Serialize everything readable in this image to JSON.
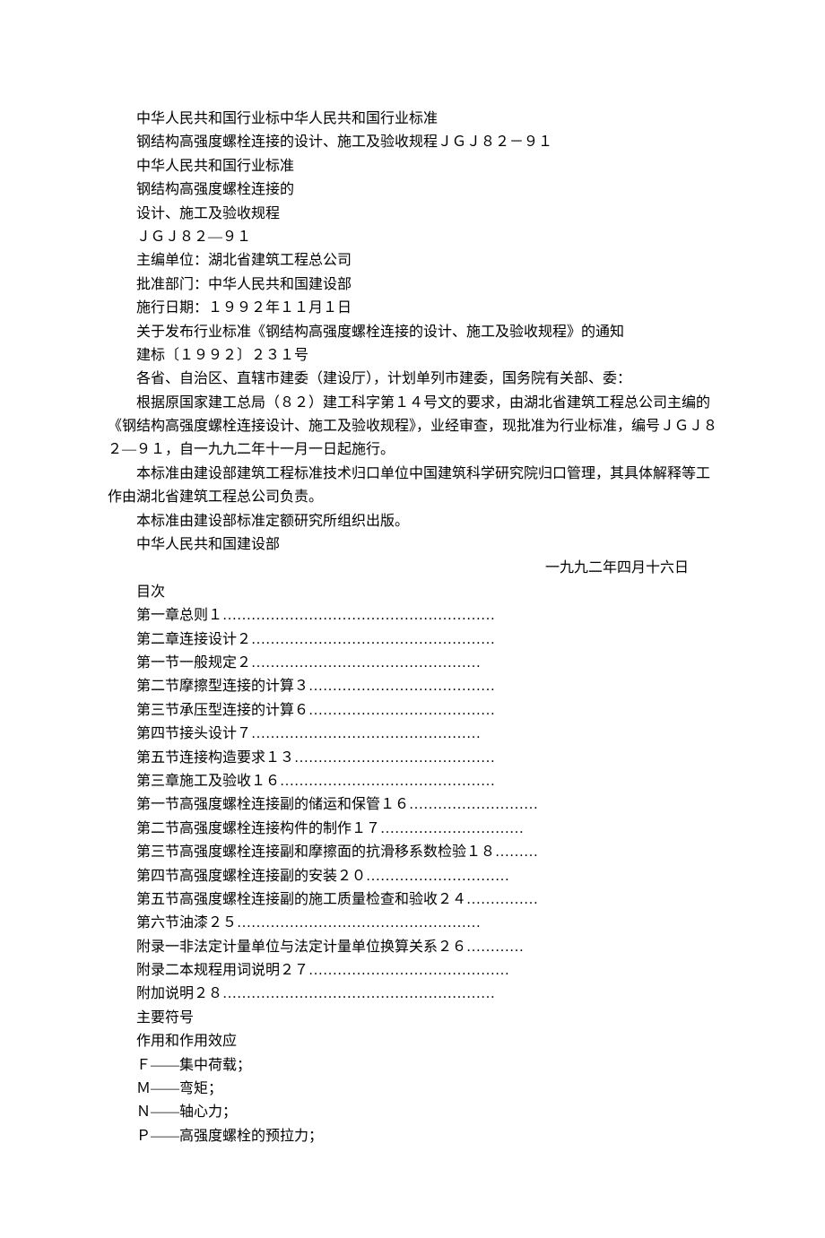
{
  "p1": "中华人民共和国行业标中华人民共和国行业标准",
  "p2": "钢结构高强度螺栓连接的设计、施工及验收规程ＪＧＪ８２－９１",
  "p3": "中华人民共和国行业标准",
  "p4": "钢结构高强度螺栓连接的",
  "p5": "设计、施工及验收规程",
  "p6": "ＪＧＪ８２—９１",
  "p7": "主编单位：湖北省建筑工程总公司",
  "p8": "批准部门：中华人民共和国建设部",
  "p9": "施行日期：１９９２年１１月１日",
  "p10": "关于发布行业标准《钢结构高强度螺栓连接的设计、施工及验收规程》的通知",
  "p11": "建标〔１９９２〕２３１号",
  "p12": "各省、自治区、直辖市建委（建设厅），计划单列市建委，国务院有关部、委：",
  "p13": "根据原国家建工总局（８２）建工科字第１４号文的要求，由湖北省建筑工程总公司主编的《钢结构高强度螺栓连接设计、施工及验收规程》，业经审查，现批准为行业标准，编号ＪＧＪ８２—９１，自一九九二年十一月一日起施行。",
  "p14": "本标准由建设部建筑工程标准技术归口单位中国建筑科学研究院归口管理，其具体解释等工作由湖北省建筑工程总公司负责。",
  "p15": "本标准由建设部标准定额研究所组织出版。",
  "p16": "中华人民共和国建设部",
  "p17": "一九九二年四月十六日",
  "p18": "目次",
  "toc": [
    "第一章总则１…………………………………………………",
    "第二章连接设计２……………………………………………",
    "第一节一般规定２…………………………………………",
    "第二节摩擦型连接的计算３…………………………………",
    "第三节承压型连接的计算６…………………………………",
    "第四节接头设计７…………………………………………",
    "第五节连接构造要求１３……………………………………",
    "第三章施工及验收１６………………………………………",
    "第一节高强度螺栓连接副的储运和保管１６………………………",
    "第二节高强度螺栓连接构件的制作１７…………………………",
    "第三节高强度螺栓连接副和摩擦面的抗滑移系数检验１８………",
    "第四节高强度螺栓连接副的安装２０…………………………",
    "第五节高强度螺栓连接副的施工质量检查和验收２４……………",
    "第六节油漆２５……………………………………………",
    "附录一非法定计量单位与法定计量单位换算关系２６…………",
    "附录二本规程用词说明２７……………………………………",
    "附加说明２８…………………………………………………"
  ],
  "p19": "主要符号",
  "p20": "作用和作用效应",
  "p21": "Ｆ——集中荷载；",
  "p22": "Ｍ——弯矩；",
  "p23": "Ｎ——轴心力；",
  "p24": "Ｐ——高强度螺栓的预拉力；"
}
